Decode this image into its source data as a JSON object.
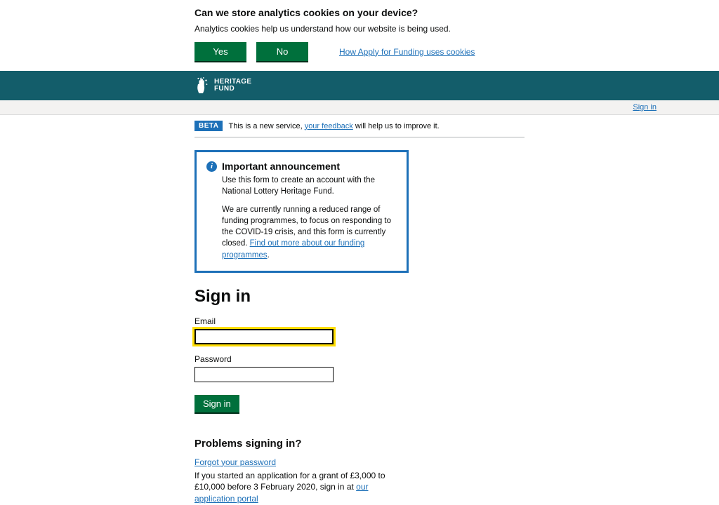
{
  "cookie": {
    "heading": "Can we store analytics cookies on your device?",
    "text": "Analytics cookies help us understand how our website is being used.",
    "yes": "Yes",
    "no": "No",
    "link": "How Apply for Funding uses cookies"
  },
  "brand": {
    "line1": "HERITAGE",
    "line2": "FUND"
  },
  "topnav": {
    "signin": "Sign in"
  },
  "beta": {
    "tag": "BETA",
    "prefix": "This is a new service, ",
    "link": "your feedback",
    "suffix": " will help us to improve it."
  },
  "announcement": {
    "title": "Important announcement",
    "p1": "Use this form to create an account with the National Lottery Heritage Fund.",
    "p2_a": "We are currently running a reduced range of funding programmes, to focus on responding to the COVID-19 crisis, and this form is currently closed. ",
    "p2_link": "Find out more about our funding programmes",
    "p2_b": "."
  },
  "signin": {
    "title": "Sign in",
    "email_label": "Email",
    "password_label": "Password",
    "button": "Sign in"
  },
  "problems": {
    "title": "Problems signing in?",
    "forgot": "Forgot your password",
    "text_a": "If you started an application for a grant of £3,000 to £10,000 before 3 February 2020, sign in at ",
    "text_link": "our application portal"
  }
}
